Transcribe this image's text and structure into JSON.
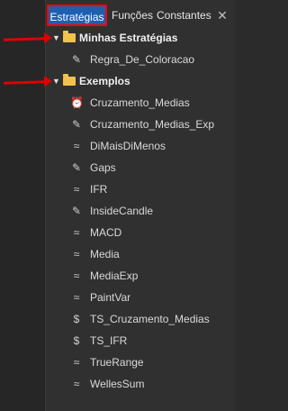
{
  "tabs": [
    {
      "label": "Estratégias",
      "active": true
    },
    {
      "label": "Funções",
      "active": false
    },
    {
      "label": "Constantes",
      "active": false
    }
  ],
  "close_glyph": "✕",
  "groups": [
    {
      "label": "Minhas Estratégias",
      "expanded": true,
      "items": [
        {
          "label": "Regra_De_Coloracao",
          "icon": "pin-icon",
          "glyph": "✎"
        }
      ]
    },
    {
      "label": "Exemplos",
      "expanded": true,
      "items": [
        {
          "label": "Cruzamento_Medias",
          "icon": "alarm-clock-icon",
          "glyph": "⏰"
        },
        {
          "label": "Cruzamento_Medias_Exp",
          "icon": "pin-icon",
          "glyph": "✎"
        },
        {
          "label": "DiMaisDiMenos",
          "icon": "wave-icon",
          "glyph": "≈"
        },
        {
          "label": "Gaps",
          "icon": "pin-icon",
          "glyph": "✎"
        },
        {
          "label": "IFR",
          "icon": "wave-icon",
          "glyph": "≈"
        },
        {
          "label": "InsideCandle",
          "icon": "pin-icon",
          "glyph": "✎"
        },
        {
          "label": "MACD",
          "icon": "wave-icon",
          "glyph": "≈"
        },
        {
          "label": "Media",
          "icon": "wave-icon",
          "glyph": "≈"
        },
        {
          "label": "MediaExp",
          "icon": "wave-icon",
          "glyph": "≈"
        },
        {
          "label": "PaintVar",
          "icon": "wave-icon",
          "glyph": "≈"
        },
        {
          "label": "TS_Cruzamento_Medias",
          "icon": "dollar-trend-icon",
          "glyph": "$"
        },
        {
          "label": "TS_IFR",
          "icon": "dollar-trend-icon",
          "glyph": "$"
        },
        {
          "label": "TrueRange",
          "icon": "wave-icon",
          "glyph": "≈"
        },
        {
          "label": "WellesSum",
          "icon": "wave-icon",
          "glyph": "≈"
        }
      ]
    }
  ],
  "expanded_glyph": "▼"
}
